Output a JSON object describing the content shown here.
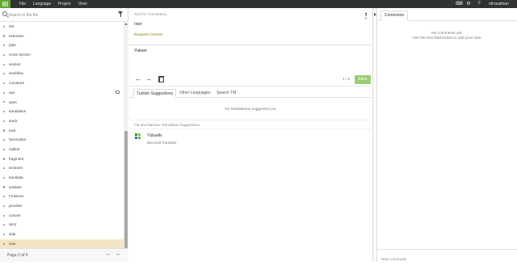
{
  "topbar": {
    "menu": [
      "File",
      "Language",
      "Project",
      "View"
    ],
    "username": "nfrosalman"
  },
  "sidebar": {
    "search_placeholder": "Search in the file",
    "items": [
      {
        "label": "set"
      },
      {
        "label": "extrusion"
      },
      {
        "label": "pipe"
      },
      {
        "label": "cross section"
      },
      {
        "label": "section"
      },
      {
        "label": "workflow"
      },
      {
        "label": "curvature"
      },
      {
        "label": "axe"
      },
      {
        "label": "axes"
      },
      {
        "label": "translation"
      },
      {
        "label": "stack"
      },
      {
        "label": "tank"
      },
      {
        "label": "facemaker"
      },
      {
        "label": "outline"
      },
      {
        "label": "fragment"
      },
      {
        "label": "sections"
      },
      {
        "label": "translate"
      },
      {
        "label": "solution"
      },
      {
        "label": "Frustrum"
      },
      {
        "label": "provider"
      },
      {
        "label": "convex"
      },
      {
        "label": "dent"
      },
      {
        "label": "slab"
      },
      {
        "label": "riser"
      }
    ],
    "page_text": "Page 2 of 6"
  },
  "editor": {
    "source_label": "Text for Translation",
    "source_text": "riser",
    "request_context": "Request Context",
    "translation_value": "Yukser",
    "count": "1 / 6",
    "save_label": "Save",
    "tabs": [
      "Turkish Suggestions",
      "Other Languages",
      "Search TM"
    ],
    "no_suggestions": "No translations suggested yet",
    "tm_header": "TM and Machine Translation Suggestions",
    "tm_word": "Yükselki",
    "tm_source": "Microsoft Translator"
  },
  "comments": {
    "tab_label": "Comments",
    "empty_line1": "No comments yet.",
    "empty_line2": "Use the text field below to add your own.",
    "new_placeholder": "New comment"
  },
  "colors": {
    "topbar": "#2f3331",
    "brand": "#5fa935",
    "save": "#9ccc74",
    "active_row": "#f2e6c5"
  }
}
